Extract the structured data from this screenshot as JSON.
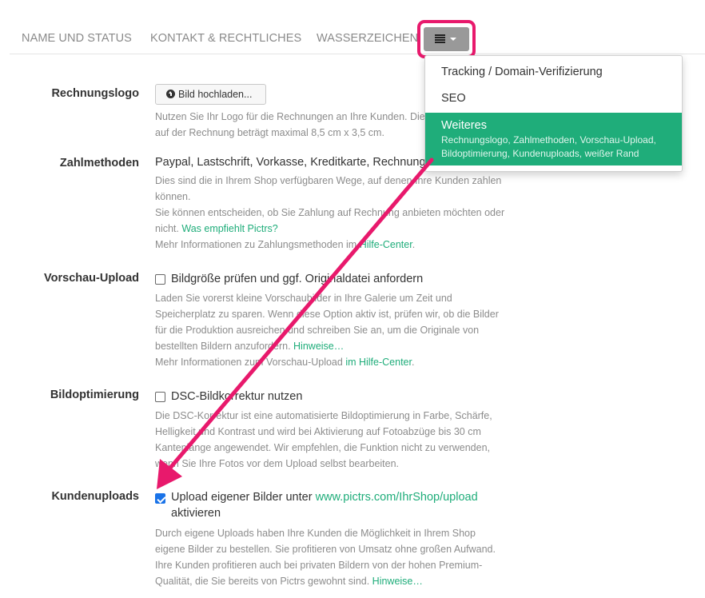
{
  "tabs": [
    {
      "label": "NAME UND STATUS"
    },
    {
      "label": "KONTAKT & RECHTLICHES"
    },
    {
      "label": "WASSERZEICHEN"
    }
  ],
  "menu_button": {
    "icon": "list-icon",
    "caret": "caret-down-icon",
    "highlight_color": "#e8196c"
  },
  "dropdown": {
    "items": [
      {
        "label": "Tracking / Domain-Verifizierung"
      },
      {
        "label": "SEO"
      }
    ],
    "active": {
      "label": "Weiteres",
      "desc_line1": "Rechnungslogo, Zahlmethoden, Vorschau-Upload,",
      "desc_line2": "Bildoptimierung, Kundenuploads, weißer Rand",
      "color": "#1fad7a"
    }
  },
  "rechnungslogo": {
    "label": "Rechnungslogo",
    "button": "Bild hochladen...",
    "help_line1": "Nutzen Sie Ihr Logo für die Rechnungen an Ihre Kunden. Die",
    "help_line2": "auf der Rechnung beträgt maximal 8,5 cm x 3,5 cm."
  },
  "zahlmethoden": {
    "label": "Zahlmethoden",
    "value": "Paypal, Lastschrift, Vorkasse, Kreditkarte, Rechnung",
    "help_line1": "Dies sind die in Ihrem Shop verfügbaren Wege, auf denen Ihre Kunden zahlen",
    "help_line2": "können.",
    "help_line3": "Sie können entscheiden, ob Sie Zahlung auf Rechnung anbieten möchten oder",
    "help_line4_pre": "nicht. ",
    "help_line4_link": "Was empfiehlt Pictrs?",
    "help_line5_pre": "Mehr Informationen zu Zahlungsmethoden im ",
    "help_line5_link": "Hilfe-Center",
    "help_line5_post": "."
  },
  "vorschau": {
    "label": "Vorschau-Upload",
    "checkbox_label": "Bildgröße prüfen und ggf. Originaldatei anfordern",
    "checked": false,
    "help_line1": "Laden Sie vorerst kleine Vorschaubilder in Ihre Galerie um Zeit und",
    "help_line2": "Speicherplatz zu sparen. Wenn diese Option aktiv ist, prüfen wir, ob die Bilder",
    "help_line3": "für die Produktion ausreichen und schreiben Sie an, um die Originale von",
    "help_line4_pre": "bestellten Bildern anzufordern. ",
    "help_line4_link": "Hinweise…",
    "help_line5_pre": "Mehr Informationen zum Vorschau-Upload ",
    "help_line5_link": "im Hilfe-Center",
    "help_line5_post": "."
  },
  "bildopt": {
    "label": "Bildoptimierung",
    "checkbox_label": "DSC-Bildkorrektur nutzen",
    "checked": false,
    "help_line1": "Die DSC-Korrektur ist eine automatisierte Bildoptimierung in Farbe, Schärfe,",
    "help_line2": "Helligkeit und Kontrast und wird bei Aktivierung auf Fotoabzüge bis 30 cm",
    "help_line3": "Kantenlänge angewendet. Wir empfehlen, die Funktion nicht zu verwenden,",
    "help_line4": "wenn Sie Ihre Fotos vor dem Upload selbst bearbeiten."
  },
  "kundenuploads": {
    "label": "Kundenuploads",
    "checkbox_pre": "Upload eigener Bilder unter ",
    "checkbox_link": "www.pictrs.com/IhrShop/upload",
    "checkbox_post": "aktivieren",
    "checked": true,
    "help_line1": "Durch eigene Uploads haben Ihre Kunden die Möglichkeit in Ihrem Shop",
    "help_line2": "eigene Bilder zu bestellen. Sie profitieren von Umsatz ohne großen Aufwand.",
    "help_line3": "Ihre Kunden profitieren auch bei privaten Bildern von der hohen Premium-",
    "help_line4_pre": "Qualität, die Sie bereits von Pictrs gewohnt sind. ",
    "help_line4_link": "Hinweise…"
  },
  "annotation": {
    "arrow_color": "#e8196c"
  }
}
